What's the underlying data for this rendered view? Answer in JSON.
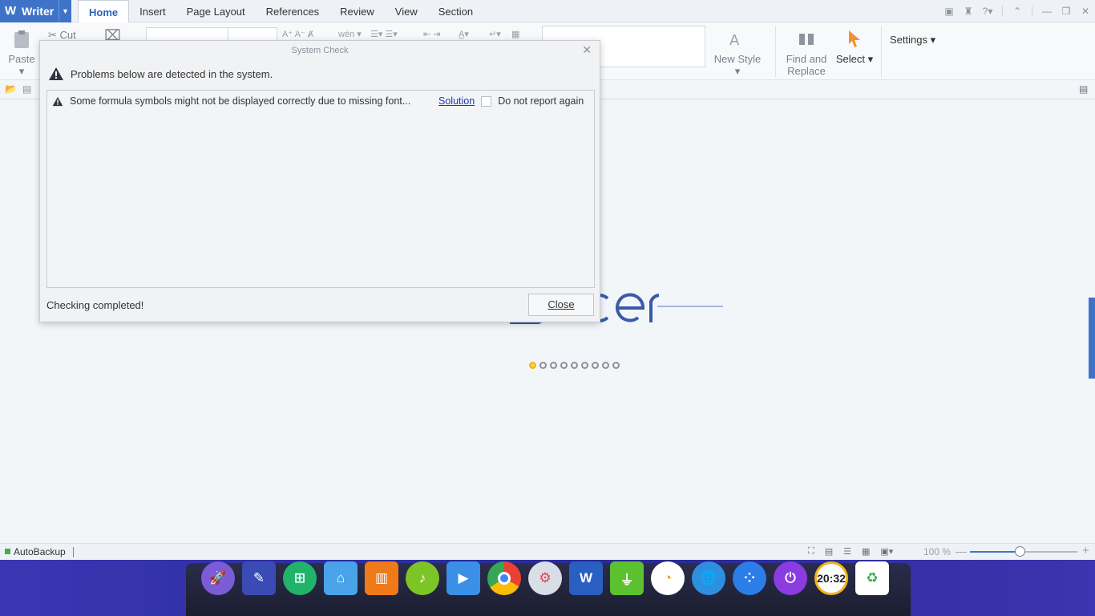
{
  "app": {
    "name": "Writer",
    "tabs": [
      "Home",
      "Insert",
      "Page Layout",
      "References",
      "Review",
      "View",
      "Section"
    ],
    "active_tab": "Home"
  },
  "ribbon": {
    "paste_label": "Paste",
    "cut_label": "Cut",
    "new_style_label": "New Style",
    "find_replace_label_1": "Find and",
    "find_replace_label_2": "Replace",
    "select_label": "Select",
    "settings_label": "Settings"
  },
  "dialog": {
    "title": "System Check",
    "header": "Problems below are detected in the system.",
    "issues": [
      {
        "message": "Some formula symbols might not be displayed correctly due to missing font...",
        "link": "Solution",
        "checkbox_label": "Do not report again",
        "checked": false
      }
    ],
    "status": "Checking completed!",
    "close_label": "Close"
  },
  "statusbar": {
    "autobackup": "AutoBackup",
    "zoom": "100 %",
    "zoom_value": 100
  },
  "dock": {
    "clock": "20:32",
    "icons": [
      "launcher-icon",
      "screenshot-icon",
      "store-icon",
      "files-icon",
      "app-store-icon",
      "music-icon",
      "video-icon",
      "chrome-icon",
      "settings-icon",
      "wps-writer-icon",
      "power-manager-icon",
      "browser-icon",
      "network-icon",
      "app-grid-icon",
      "shutdown-icon",
      "clock-icon",
      "trash-icon"
    ]
  },
  "colors": {
    "accent": "#3f73c8",
    "link": "#1a37b8",
    "dock_bg": "#2b2b95"
  }
}
